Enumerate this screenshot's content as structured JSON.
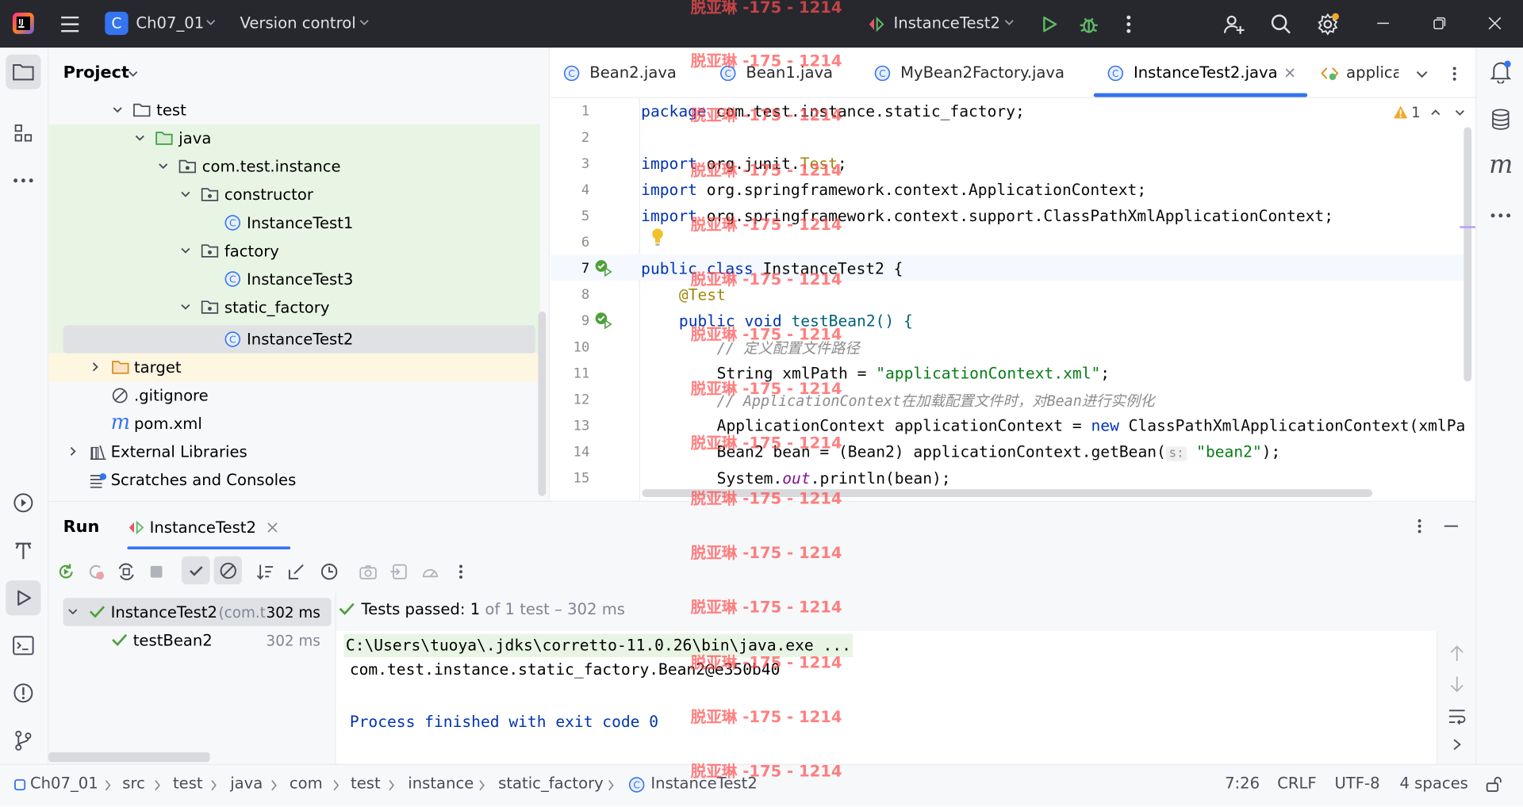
{
  "titlebar": {
    "project_badge": "C",
    "project_name": "Ch07_01",
    "vcs": "Version control",
    "run_config": "InstanceTest2"
  },
  "project_panel": {
    "title": "Project",
    "items": [
      {
        "label": "test"
      },
      {
        "label": "java"
      },
      {
        "label": "com.test.instance"
      },
      {
        "label": "constructor"
      },
      {
        "label": "InstanceTest1"
      },
      {
        "label": "factory"
      },
      {
        "label": "InstanceTest3"
      },
      {
        "label": "static_factory"
      },
      {
        "label": "InstanceTest2"
      },
      {
        "label": "target"
      },
      {
        "label": ".gitignore"
      },
      {
        "label": "pom.xml"
      },
      {
        "label": "External Libraries"
      },
      {
        "label": "Scratches and Consoles"
      }
    ]
  },
  "editor_tabs": [
    {
      "label": "Bean2.java"
    },
    {
      "label": "Bean1.java"
    },
    {
      "label": "MyBean2Factory.java"
    },
    {
      "label": "InstanceTest2.java"
    },
    {
      "label": "applica"
    }
  ],
  "editor": {
    "warnings": "1",
    "line_numbers": [
      "1",
      "2",
      "3",
      "4",
      "5",
      "6",
      "7",
      "8",
      "9",
      "10",
      "11",
      "12",
      "13",
      "14",
      "15"
    ],
    "lines": {
      "l1_kw": "package",
      "l1_rest": " com.test.instance.static_factory;",
      "l3_kw": "import",
      "l3_a": " org.junit.",
      "l3_b": "Test",
      "l3_c": ";",
      "l4_kw": "import",
      "l4_rest": " org.springframework.context.ApplicationContext;",
      "l5_kw": "import",
      "l5_rest": " org.springframework.context.support.ClassPathXmlApplicationContext;",
      "l7_kw": "public class",
      "l7_rest": " InstanceTest2 {",
      "l8_an": "@Test",
      "l9_kw": "public void",
      "l9_rest": " testBean2() {",
      "l10_cm": "// 定义配置文件路径",
      "l11_a": "String xmlPath = ",
      "l11_str": "\"applicationContext.xml\"",
      "l11_c": ";",
      "l12_cm": "// ApplicationContext在加载配置文件时，对Bean进行实例化",
      "l13_a": "ApplicationContext applicationContext = ",
      "l13_kw": "new",
      "l13_b": " ClassPathXmlApplicationContext(xmlPa",
      "l14_a": "Bean2 bean = (Bean2) applicationContext.getBean(",
      "l14_hint": "s:",
      "l14_str": "\"bean2\"",
      "l14_c": ");",
      "l15_a": "System.",
      "l15_fld": "out",
      "l15_b": ".println(bean);"
    }
  },
  "run_panel": {
    "title": "Run",
    "tab": "InstanceTest2",
    "tests": [
      {
        "name": "InstanceTest2",
        "extra": "(com.t",
        "time": "302 ms"
      },
      {
        "name": "testBean2",
        "time": "302 ms"
      }
    ],
    "status_prefix": "Tests passed: ",
    "status_count": "1",
    "status_suffix": " of 1 test – 302 ms",
    "console": [
      "C:\\Users\\tuoya\\.jdks\\corretto-11.0.26\\bin\\java.exe ...",
      "com.test.instance.static_factory.Bean2@e350b40",
      "",
      "Process finished with exit code 0"
    ]
  },
  "statusbar": {
    "breadcrumbs": [
      "Ch07_01",
      "src",
      "test",
      "java",
      "com",
      "test",
      "instance",
      "static_factory",
      "InstanceTest2"
    ],
    "position": "7:26",
    "line_sep": "CRLF",
    "encoding": "UTF-8",
    "indent": "4 spaces"
  },
  "watermark": "脱亚琳 -175 - 1214",
  "colors": {
    "accent": "#3574f0",
    "run_green": "#4ea13c",
    "titlebar": "#27282e",
    "tree_selected": "#dfe1e5",
    "test_green_bg": "#e8f5e4",
    "target_bg": "#fdf6e0"
  }
}
